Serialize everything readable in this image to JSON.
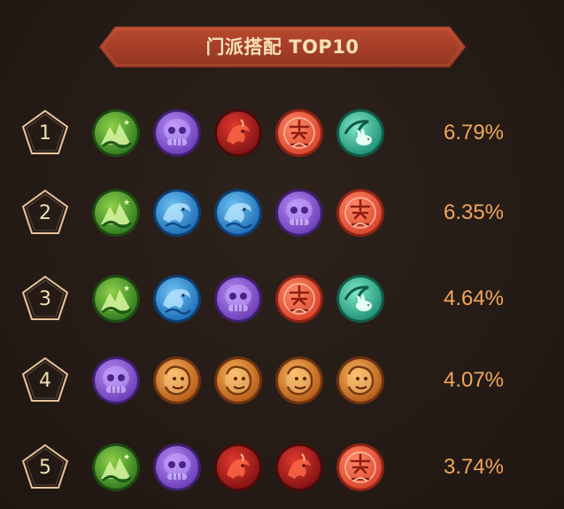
{
  "title": "门派搭配 TOP10",
  "colors": {
    "background": "#261c17",
    "banner": "#a8402a",
    "percent_text": "#f2a65a",
    "rank_text": "#f3dfb6"
  },
  "rows": [
    {
      "rank": "1",
      "percent": "6.79%",
      "sects": [
        "green-mountain",
        "purple-skull",
        "red-dragon",
        "orange-red-seal",
        "teal-rabbit"
      ]
    },
    {
      "rank": "2",
      "percent": "6.35%",
      "sects": [
        "green-mountain",
        "blue-dragon",
        "blue-dragon",
        "purple-skull",
        "orange-red-seal"
      ]
    },
    {
      "rank": "3",
      "percent": "4.64%",
      "sects": [
        "green-mountain",
        "blue-dragon",
        "purple-skull",
        "orange-red-seal",
        "teal-rabbit"
      ]
    },
    {
      "rank": "4",
      "percent": "4.07%",
      "sects": [
        "purple-skull",
        "orange-lion",
        "orange-lion",
        "orange-lion",
        "orange-lion"
      ]
    },
    {
      "rank": "5",
      "percent": "3.74%",
      "sects": [
        "green-mountain",
        "purple-skull",
        "red-dragon",
        "red-dragon",
        "orange-red-seal"
      ]
    }
  ]
}
